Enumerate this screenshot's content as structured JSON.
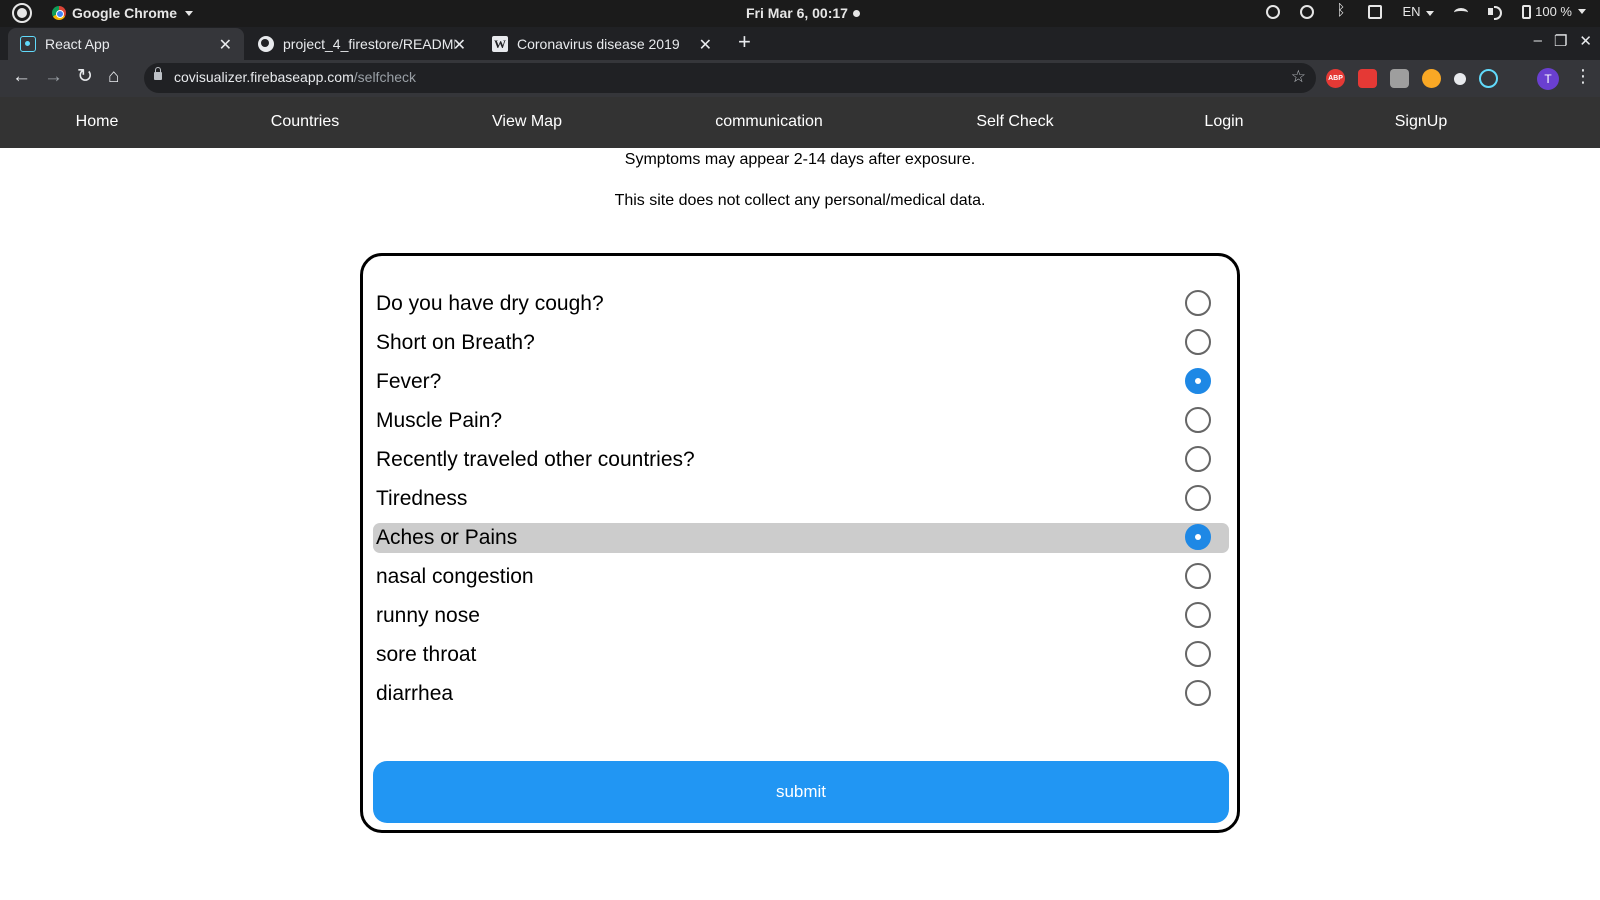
{
  "os": {
    "app_name": "Google Chrome",
    "clock": "Fri Mar  6, 00:17",
    "language": "EN",
    "battery": "100 %"
  },
  "browser": {
    "tabs": [
      {
        "title": "React App",
        "icon": "react-icon",
        "active": true
      },
      {
        "title": "project_4_firestore/README",
        "icon": "github-icon",
        "active": false
      },
      {
        "title": "Coronavirus disease 2019",
        "icon": "wikipedia-icon",
        "active": false
      }
    ],
    "url_host": "covisualizer.firebaseapp.com",
    "url_path": "/selfcheck",
    "profile_initial": "T",
    "extensions": [
      "abp-icon",
      "play-icon",
      "print-icon",
      "owl-icon",
      "feather-icon",
      "react-devtools-icon"
    ]
  },
  "nav": {
    "items": [
      "Home",
      "Countries",
      "View Map",
      "communication",
      "Self Check",
      "Login",
      "SignUp"
    ]
  },
  "content": {
    "line1": "Symptoms may appear 2-14 days after exposure.",
    "line2": "This site does not collect any personal/medical data."
  },
  "form": {
    "questions": [
      {
        "label": "Do you have dry cough?",
        "checked": false
      },
      {
        "label": "Short on Breath?",
        "checked": false
      },
      {
        "label": "Fever?",
        "checked": true
      },
      {
        "label": "Muscle Pain?",
        "checked": false
      },
      {
        "label": "Recently traveled other countries?",
        "checked": false
      },
      {
        "label": "Tiredness",
        "checked": false
      },
      {
        "label": "Aches or Pains",
        "checked": true,
        "highlighted": true
      },
      {
        "label": "nasal congestion",
        "checked": false
      },
      {
        "label": "runny nose",
        "checked": false
      },
      {
        "label": "sore throat",
        "checked": false
      },
      {
        "label": "diarrhea",
        "checked": false
      }
    ],
    "submit_label": "submit"
  },
  "colors": {
    "nav_bg": "#333333",
    "accent": "#2196f3",
    "highlight_row": "#cccccc"
  }
}
